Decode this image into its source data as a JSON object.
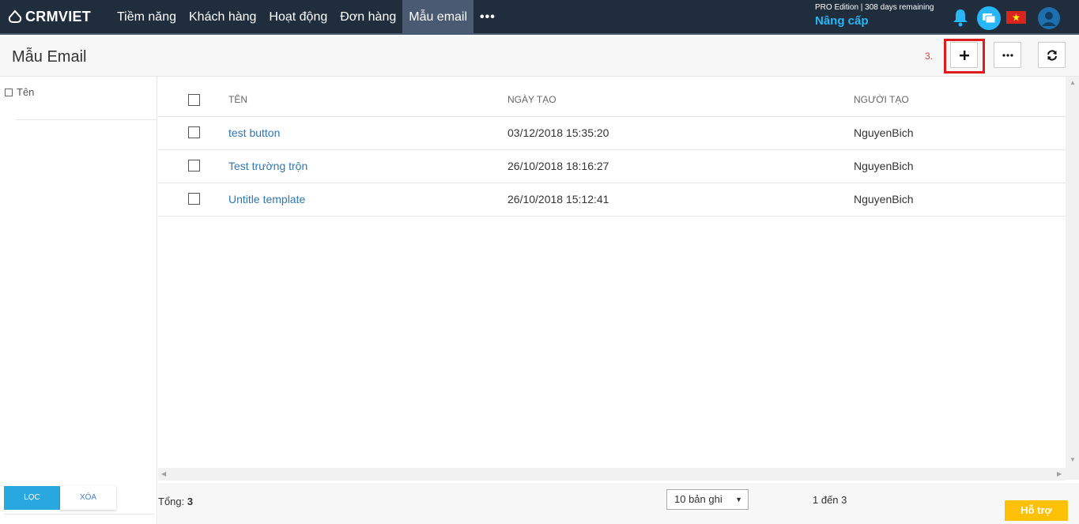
{
  "app": {
    "brand": "CRMVIET"
  },
  "nav": {
    "items": [
      {
        "label": "Tiềm năng"
      },
      {
        "label": "Khách hàng"
      },
      {
        "label": "Hoạt động"
      },
      {
        "label": "Đơn hàng"
      },
      {
        "label": "Mẫu email"
      }
    ],
    "active_index": 4,
    "more_label": "•••"
  },
  "account": {
    "edition_text": "PRO Edition | 308 days remaining",
    "upgrade_label": "Nâng cấp"
  },
  "colors": {
    "topbar": "#1f2d3d",
    "accent": "#29b6f6",
    "link": "#3276b1",
    "highlight": "#e11b1b",
    "support": "#ffc107"
  },
  "page": {
    "title": "Mẫu Email"
  },
  "toolbar": {
    "step_label": "3.",
    "add_icon": "plus-icon",
    "more_icon": "ellipsis-icon",
    "refresh_icon": "refresh-icon"
  },
  "sidebar": {
    "filter_label": "Tên",
    "filter_button": "LỌC",
    "clear_button": "XÓA"
  },
  "table": {
    "headers": {
      "name": "TÊN",
      "created": "NGÀY TẠO",
      "creator": "NGƯỜI TẠO"
    },
    "rows": [
      {
        "name": "test button",
        "created": "03/12/2018 15:35:20",
        "creator": "NguyenBich"
      },
      {
        "name": "Test trường trộn",
        "created": "26/10/2018 18:16:27",
        "creator": "NguyenBich"
      },
      {
        "name": "Untitle template",
        "created": "26/10/2018 15:12:41",
        "creator": "NguyenBich"
      }
    ]
  },
  "footer": {
    "total_label": "Tổng:",
    "total_count": "3",
    "page_size": "10 bản ghi",
    "range": "1 đến 3",
    "support_label": "Hỗ trợ"
  }
}
